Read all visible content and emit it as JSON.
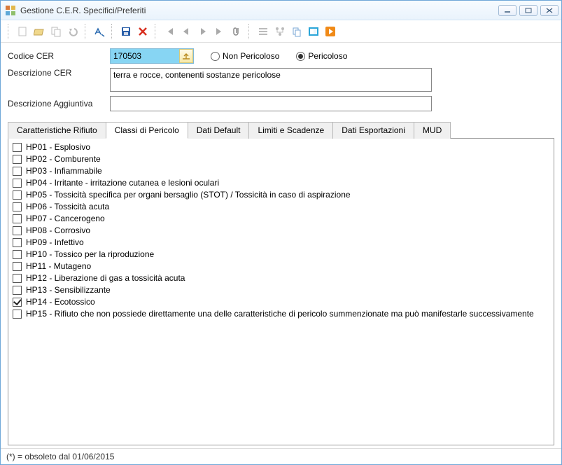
{
  "window": {
    "title": "Gestione C.E.R. Specifici/Preferiti"
  },
  "form": {
    "codice_label": "Codice CER",
    "codice_value": "170503",
    "desc_label": "Descrizione CER",
    "desc_value": "terra e rocce, contenenti sostanze pericolose",
    "desc2_label": "Descrizione Aggiuntiva",
    "desc2_value": "",
    "radio_non_peric": "Non Pericoloso",
    "radio_peric": "Pericoloso",
    "peric_selected": "pericoloso"
  },
  "tabs": {
    "items": [
      "Caratteristiche Rifiuto",
      "Classi di Pericolo",
      "Dati Default",
      "Limiti e Scadenze",
      "Dati Esportazioni",
      "MUD"
    ],
    "active": 1
  },
  "hazard_classes": [
    {
      "label": "HP01 - Esplosivo",
      "checked": false
    },
    {
      "label": "HP02 - Comburente",
      "checked": false
    },
    {
      "label": "HP03 - Infiammabile",
      "checked": false
    },
    {
      "label": "HP04 - Irritante - irritazione cutanea e lesioni oculari",
      "checked": false
    },
    {
      "label": "HP05 - Tossicità specifica per organi bersaglio (STOT) / Tossicità in caso di aspirazione",
      "checked": false
    },
    {
      "label": "HP06 - Tossicità acuta",
      "checked": false
    },
    {
      "label": "HP07 - Cancerogeno",
      "checked": false
    },
    {
      "label": "HP08 - Corrosivo",
      "checked": false
    },
    {
      "label": "HP09 - Infettivo",
      "checked": false
    },
    {
      "label": "HP10 - Tossico per la riproduzione",
      "checked": false
    },
    {
      "label": "HP11 - Mutageno",
      "checked": false
    },
    {
      "label": "HP12 - Liberazione di gas a tossicità acuta",
      "checked": false
    },
    {
      "label": "HP13 - Sensibilizzante",
      "checked": false
    },
    {
      "label": "HP14 - Ecotossico",
      "checked": true
    },
    {
      "label": "HP15 - Rifiuto che non possiede direttamente una delle caratteristiche di pericolo summenzionate ma può manifestarle successivamente",
      "checked": false
    }
  ],
  "footer": {
    "note": "(*) = obsoleto dal 01/06/2015"
  }
}
